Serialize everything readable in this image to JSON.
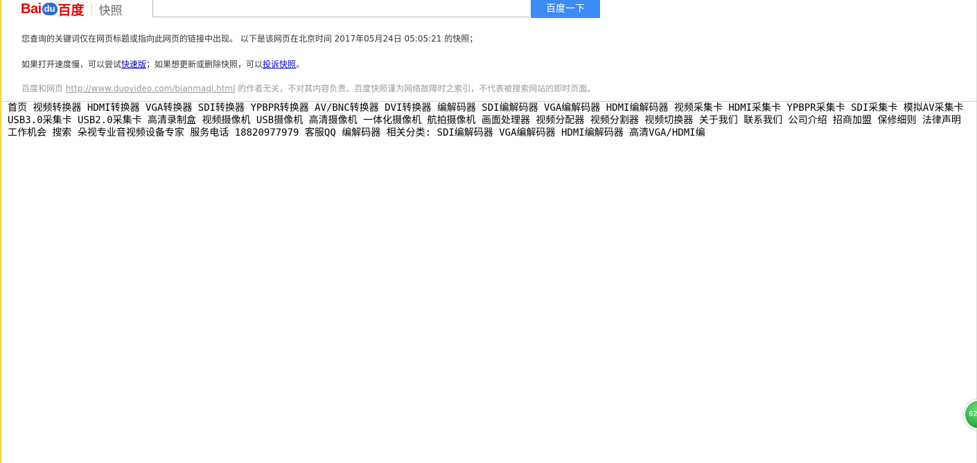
{
  "header": {
    "logo_bai": "Bai",
    "logo_paw": "du",
    "logo_cn": "百度",
    "logo_snap": "快照",
    "search_value": "",
    "search_button": "百度一下"
  },
  "notice": {
    "line1": "您查询的关键词仅在网页标题或指向此网页的链接中出现。  以下是该网页在北京时间 2017年05月24日 05:05:21 的快照；",
    "line2_pre": "如果打开速度慢，可以尝试",
    "line2_link1": "快速版",
    "line2_mid": "；如果想更新或删除快照，可以",
    "line2_link2": "投诉快照",
    "line2_post": "。",
    "line3_pre": "百度和网页 ",
    "line3_url": "http://www.duovideo.com/bianmaqi.html",
    "line3_post": " 的作者无关，不对其内容负责。百度快照谨为网络故障时之索引，不代表被搜索网站的即时页面。"
  },
  "cached_links": [
    "首页",
    "视频转换器",
    "HDMI转换器",
    "VGA转换器",
    "SDI转换器",
    "YPBPR转换器",
    "AV/BNC转换器",
    "DVI转换器",
    "编解码器",
    "SDI编解码器",
    "VGA编解码器",
    "HDMI编解码器",
    "视频采集卡",
    "HDMI采集卡",
    "YPBPR采集卡",
    "SDI采集卡",
    "模拟AV采集卡",
    "USB3.0采集卡",
    "USB2.0采集卡",
    "高清录制盒",
    "视频摄像机",
    "USB摄像机",
    "高清摄像机",
    "一体化摄像机",
    "航拍摄像机",
    "画面处理器",
    "视频分配器",
    "视频分割器",
    "视频切换器",
    "关于我们",
    "联系我们",
    "公司介绍",
    "招商加盟",
    "保修细则",
    "法律声明",
    "工作机会",
    "搜索",
    "朵视专业音视频设备专家",
    "服务电话 18820977979",
    "客服QQ",
    "编解码器",
    "相关分类:",
    "SDI编解码器",
    "VGA编解码器",
    "HDMI编解码器",
    "高清VGA/HDMI编"
  ],
  "float_badge": "62"
}
